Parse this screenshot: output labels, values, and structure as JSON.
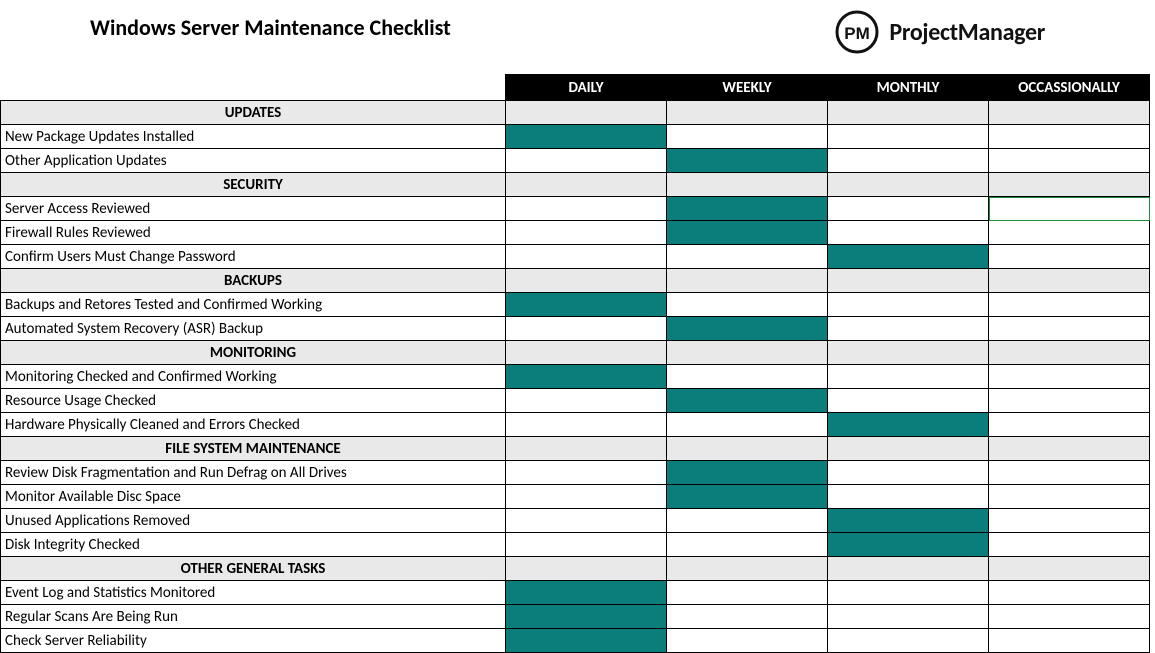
{
  "title": "Windows Server Maintenance Checklist",
  "brand": {
    "logo_text": "PM",
    "name": "ProjectManager"
  },
  "columns": [
    "DAILY",
    "WEEKLY",
    "MONTHLY",
    "OCCASSIONALLY"
  ],
  "colors": {
    "filled": "#0b7d7b",
    "header_bg": "#000000",
    "section_bg": "#e9e9e9"
  },
  "sections": [
    {
      "name": "UPDATES",
      "tasks": [
        {
          "label": "New Package Updates Installed",
          "freq": [
            true,
            false,
            false,
            false
          ]
        },
        {
          "label": "Other Application Updates",
          "freq": [
            false,
            true,
            false,
            false
          ]
        }
      ]
    },
    {
      "name": "SECURITY",
      "tasks": [
        {
          "label": "Server Access Reviewed",
          "freq": [
            false,
            true,
            false,
            false
          ],
          "selected_col": 3
        },
        {
          "label": "Firewall Rules Reviewed",
          "freq": [
            false,
            true,
            false,
            false
          ]
        },
        {
          "label": "Confirm Users Must Change Password",
          "freq": [
            false,
            false,
            true,
            false
          ]
        }
      ]
    },
    {
      "name": "BACKUPS",
      "tasks": [
        {
          "label": "Backups and Retores Tested and Confirmed Working",
          "freq": [
            true,
            false,
            false,
            false
          ]
        },
        {
          "label": "Automated System Recovery (ASR) Backup",
          "freq": [
            false,
            true,
            false,
            false
          ]
        }
      ]
    },
    {
      "name": "MONITORING",
      "tasks": [
        {
          "label": "Monitoring Checked and Confirmed Working",
          "freq": [
            true,
            false,
            false,
            false
          ]
        },
        {
          "label": "Resource Usage Checked",
          "freq": [
            false,
            true,
            false,
            false
          ]
        },
        {
          "label": "Hardware Physically Cleaned and Errors Checked",
          "freq": [
            false,
            false,
            true,
            false
          ]
        }
      ]
    },
    {
      "name": "FILE SYSTEM MAINTENANCE",
      "tasks": [
        {
          "label": "Review Disk Fragmentation and Run Defrag on All Drives",
          "freq": [
            false,
            true,
            false,
            false
          ]
        },
        {
          "label": "Monitor Available Disc Space",
          "freq": [
            false,
            true,
            false,
            false
          ]
        },
        {
          "label": "Unused Applications Removed",
          "freq": [
            false,
            false,
            true,
            false
          ]
        },
        {
          "label": "Disk Integrity Checked",
          "freq": [
            false,
            false,
            true,
            false
          ]
        }
      ]
    },
    {
      "name": "OTHER GENERAL TASKS",
      "tasks": [
        {
          "label": "Event Log and Statistics Monitored",
          "freq": [
            true,
            false,
            false,
            false
          ]
        },
        {
          "label": "Regular Scans Are Being Run",
          "freq": [
            true,
            false,
            false,
            false
          ]
        },
        {
          "label": "Check Server Reliability",
          "freq": [
            true,
            false,
            false,
            false
          ]
        }
      ]
    }
  ]
}
